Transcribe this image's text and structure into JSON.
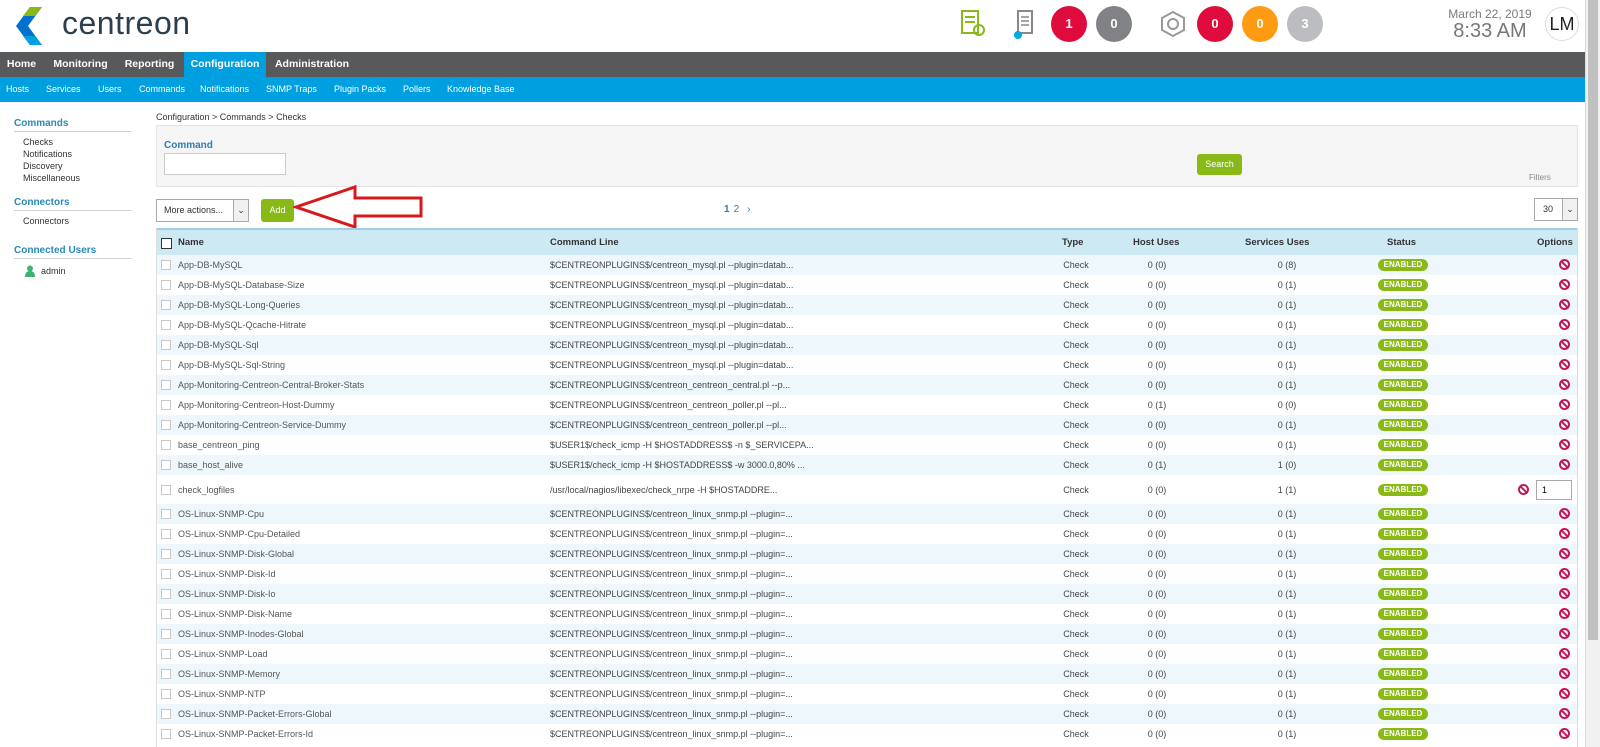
{
  "app": {
    "name": "centreon"
  },
  "header": {
    "icons": [
      "pollers-icon",
      "database-icon"
    ],
    "hosts_counts": {
      "down": "1",
      "unreachable": "0"
    },
    "services_counts": {
      "critical": "0",
      "warning": "0",
      "unknown": "3"
    },
    "date": "March 22, 2019",
    "time": "8:33 AM",
    "user_initials": "LM",
    "colors": {
      "red": "#e00b3d",
      "gray": "#818285",
      "orange": "#ff9a13",
      "lightgray": "#bcbdc0"
    }
  },
  "menu": {
    "main": [
      "Home",
      "Monitoring",
      "Reporting",
      "Configuration",
      "Administration"
    ],
    "active": "Configuration",
    "sub": [
      "Hosts",
      "Services",
      "Users",
      "Commands",
      "Notifications",
      "SNMP Traps",
      "Plugin Packs",
      "Pollers",
      "Knowledge Base"
    ]
  },
  "sidebar": {
    "sections": [
      {
        "title": "Commands",
        "items": [
          "Checks",
          "Notifications",
          "Discovery",
          "Miscellaneous"
        ]
      },
      {
        "title": "Connectors",
        "items": [
          "Connectors"
        ]
      },
      {
        "title": "Connected Users",
        "items": [
          "admin"
        ]
      }
    ]
  },
  "breadcrumb": "Configuration  >  Commands  >  Checks",
  "filters": {
    "label": "Command",
    "value": "",
    "search_label": "Search",
    "tab_label": "Filters"
  },
  "actions": {
    "more_actions": "More actions...",
    "add_label": "Add",
    "pages": [
      "1",
      "2"
    ],
    "next": "›",
    "per_page": "30"
  },
  "table": {
    "columns": [
      "Name",
      "Command Line",
      "Type",
      "Host Uses",
      "Services Uses",
      "Status",
      "Options"
    ],
    "rows": [
      {
        "name": "App-DB-MySQL",
        "cmd": "$CENTREONPLUGINS$/centreon_mysql.pl --plugin=datab...",
        "type": "Check",
        "host": "0 (0)",
        "svc": "0 (8)",
        "status": "ENABLED"
      },
      {
        "name": "App-DB-MySQL-Database-Size",
        "cmd": "$CENTREONPLUGINS$/centreon_mysql.pl --plugin=datab...",
        "type": "Check",
        "host": "0 (0)",
        "svc": "0 (1)",
        "status": "ENABLED"
      },
      {
        "name": "App-DB-MySQL-Long-Queries",
        "cmd": "$CENTREONPLUGINS$/centreon_mysql.pl --plugin=datab...",
        "type": "Check",
        "host": "0 (0)",
        "svc": "0 (1)",
        "status": "ENABLED"
      },
      {
        "name": "App-DB-MySQL-Qcache-Hitrate",
        "cmd": "$CENTREONPLUGINS$/centreon_mysql.pl --plugin=datab...",
        "type": "Check",
        "host": "0 (0)",
        "svc": "0 (1)",
        "status": "ENABLED"
      },
      {
        "name": "App-DB-MySQL-Sql",
        "cmd": "$CENTREONPLUGINS$/centreon_mysql.pl --plugin=datab...",
        "type": "Check",
        "host": "0 (0)",
        "svc": "0 (1)",
        "status": "ENABLED"
      },
      {
        "name": "App-DB-MySQL-Sql-String",
        "cmd": "$CENTREONPLUGINS$/centreon_mysql.pl --plugin=datab...",
        "type": "Check",
        "host": "0 (0)",
        "svc": "0 (1)",
        "status": "ENABLED"
      },
      {
        "name": "App-Monitoring-Centreon-Central-Broker-Stats",
        "cmd": "$CENTREONPLUGINS$/centreon_centreon_central.pl --p...",
        "type": "Check",
        "host": "0 (0)",
        "svc": "0 (1)",
        "status": "ENABLED"
      },
      {
        "name": "App-Monitoring-Centreon-Host-Dummy",
        "cmd": "$CENTREONPLUGINS$/centreon_centreon_poller.pl --pl...",
        "type": "Check",
        "host": "0 (1)",
        "svc": "0 (0)",
        "status": "ENABLED"
      },
      {
        "name": "App-Monitoring-Centreon-Service-Dummy",
        "cmd": "$CENTREONPLUGINS$/centreon_centreon_poller.pl --pl...",
        "type": "Check",
        "host": "0 (0)",
        "svc": "0 (1)",
        "status": "ENABLED"
      },
      {
        "name": "base_centreon_ping",
        "cmd": "$USER1$/check_icmp -H $HOSTADDRESS$ -n $_SERVICEPA...",
        "type": "Check",
        "host": "0 (0)",
        "svc": "0 (1)",
        "status": "ENABLED"
      },
      {
        "name": "base_host_alive",
        "cmd": "$USER1$/check_icmp -H $HOSTADDRESS$ -w 3000.0,80% ...",
        "type": "Check",
        "host": "0 (1)",
        "svc": "1 (0)",
        "status": "ENABLED"
      },
      {
        "name": "check_logfiles",
        "cmd": "/usr/local/nagios/libexec/check_nrpe -H $HOSTADDRE...",
        "type": "Check",
        "host": "0 (0)",
        "svc": "1 (1)",
        "status": "ENABLED",
        "dup": "1"
      },
      {
        "name": "OS-Linux-SNMP-Cpu",
        "cmd": "$CENTREONPLUGINS$/centreon_linux_snmp.pl --plugin=...",
        "type": "Check",
        "host": "0 (0)",
        "svc": "0 (1)",
        "status": "ENABLED"
      },
      {
        "name": "OS-Linux-SNMP-Cpu-Detailed",
        "cmd": "$CENTREONPLUGINS$/centreon_linux_snmp.pl --plugin=...",
        "type": "Check",
        "host": "0 (0)",
        "svc": "0 (1)",
        "status": "ENABLED"
      },
      {
        "name": "OS-Linux-SNMP-Disk-Global",
        "cmd": "$CENTREONPLUGINS$/centreon_linux_snmp.pl --plugin=...",
        "type": "Check",
        "host": "0 (0)",
        "svc": "0 (1)",
        "status": "ENABLED"
      },
      {
        "name": "OS-Linux-SNMP-Disk-Id",
        "cmd": "$CENTREONPLUGINS$/centreon_linux_snmp.pl --plugin=...",
        "type": "Check",
        "host": "0 (0)",
        "svc": "0 (1)",
        "status": "ENABLED"
      },
      {
        "name": "OS-Linux-SNMP-Disk-Io",
        "cmd": "$CENTREONPLUGINS$/centreon_linux_snmp.pl --plugin=...",
        "type": "Check",
        "host": "0 (0)",
        "svc": "0 (1)",
        "status": "ENABLED"
      },
      {
        "name": "OS-Linux-SNMP-Disk-Name",
        "cmd": "$CENTREONPLUGINS$/centreon_linux_snmp.pl --plugin=...",
        "type": "Check",
        "host": "0 (0)",
        "svc": "0 (1)",
        "status": "ENABLED"
      },
      {
        "name": "OS-Linux-SNMP-Inodes-Global",
        "cmd": "$CENTREONPLUGINS$/centreon_linux_snmp.pl --plugin=...",
        "type": "Check",
        "host": "0 (0)",
        "svc": "0 (1)",
        "status": "ENABLED"
      },
      {
        "name": "OS-Linux-SNMP-Load",
        "cmd": "$CENTREONPLUGINS$/centreon_linux_snmp.pl --plugin=...",
        "type": "Check",
        "host": "0 (0)",
        "svc": "0 (1)",
        "status": "ENABLED"
      },
      {
        "name": "OS-Linux-SNMP-Memory",
        "cmd": "$CENTREONPLUGINS$/centreon_linux_snmp.pl --plugin=...",
        "type": "Check",
        "host": "0 (0)",
        "svc": "0 (1)",
        "status": "ENABLED"
      },
      {
        "name": "OS-Linux-SNMP-NTP",
        "cmd": "$CENTREONPLUGINS$/centreon_linux_snmp.pl --plugin=...",
        "type": "Check",
        "host": "0 (0)",
        "svc": "0 (1)",
        "status": "ENABLED"
      },
      {
        "name": "OS-Linux-SNMP-Packet-Errors-Global",
        "cmd": "$CENTREONPLUGINS$/centreon_linux_snmp.pl --plugin=...",
        "type": "Check",
        "host": "0 (0)",
        "svc": "0 (1)",
        "status": "ENABLED"
      },
      {
        "name": "OS-Linux-SNMP-Packet-Errors-Id",
        "cmd": "$CENTREONPLUGINS$/centreon_linux_snmp.pl --plugin=...",
        "type": "Check",
        "host": "0 (0)",
        "svc": "0 (1)",
        "status": "ENABLED"
      }
    ]
  }
}
